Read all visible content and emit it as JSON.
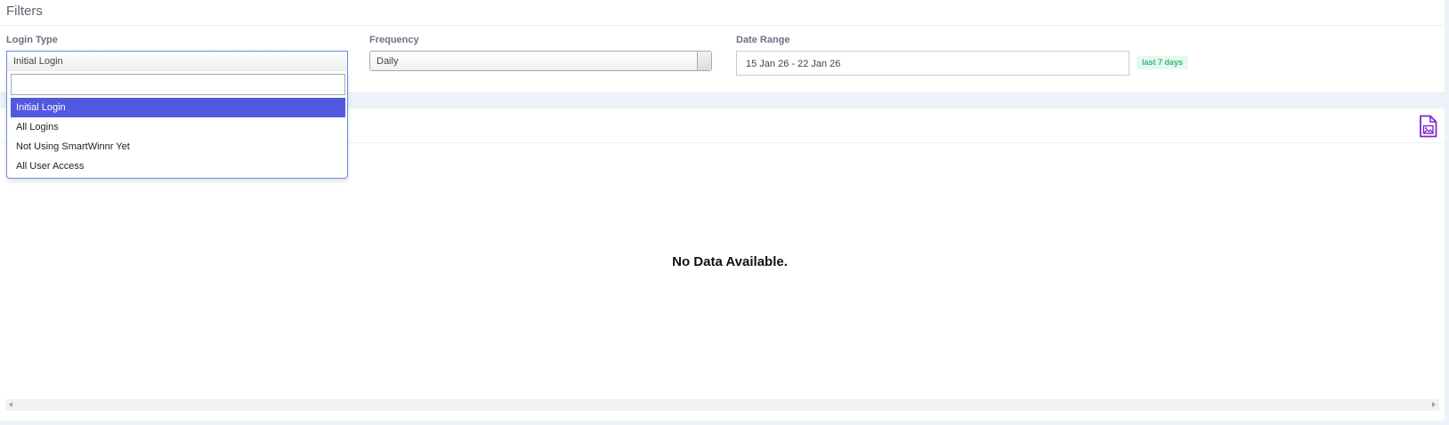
{
  "filters": {
    "title": "Filters",
    "login_type": {
      "label": "Login Type",
      "selected": "Initial Login",
      "search_value": "",
      "options": [
        "Initial Login",
        "All Logins",
        "Not Using SmartWinnr Yet",
        "All User Access"
      ]
    },
    "frequency": {
      "label": "Frequency",
      "selected": "Daily"
    },
    "date_range": {
      "label": "Date Range",
      "value": "15 Jan 26 - 22 Jan 26",
      "badge": "last 7 days"
    }
  },
  "chart": {
    "empty_message": "No Data Available.",
    "export_icon": "image-file-icon"
  },
  "colors": {
    "highlight": "#5059df",
    "accent_purple": "#7b28c9",
    "badge_green": "#35b77a"
  }
}
